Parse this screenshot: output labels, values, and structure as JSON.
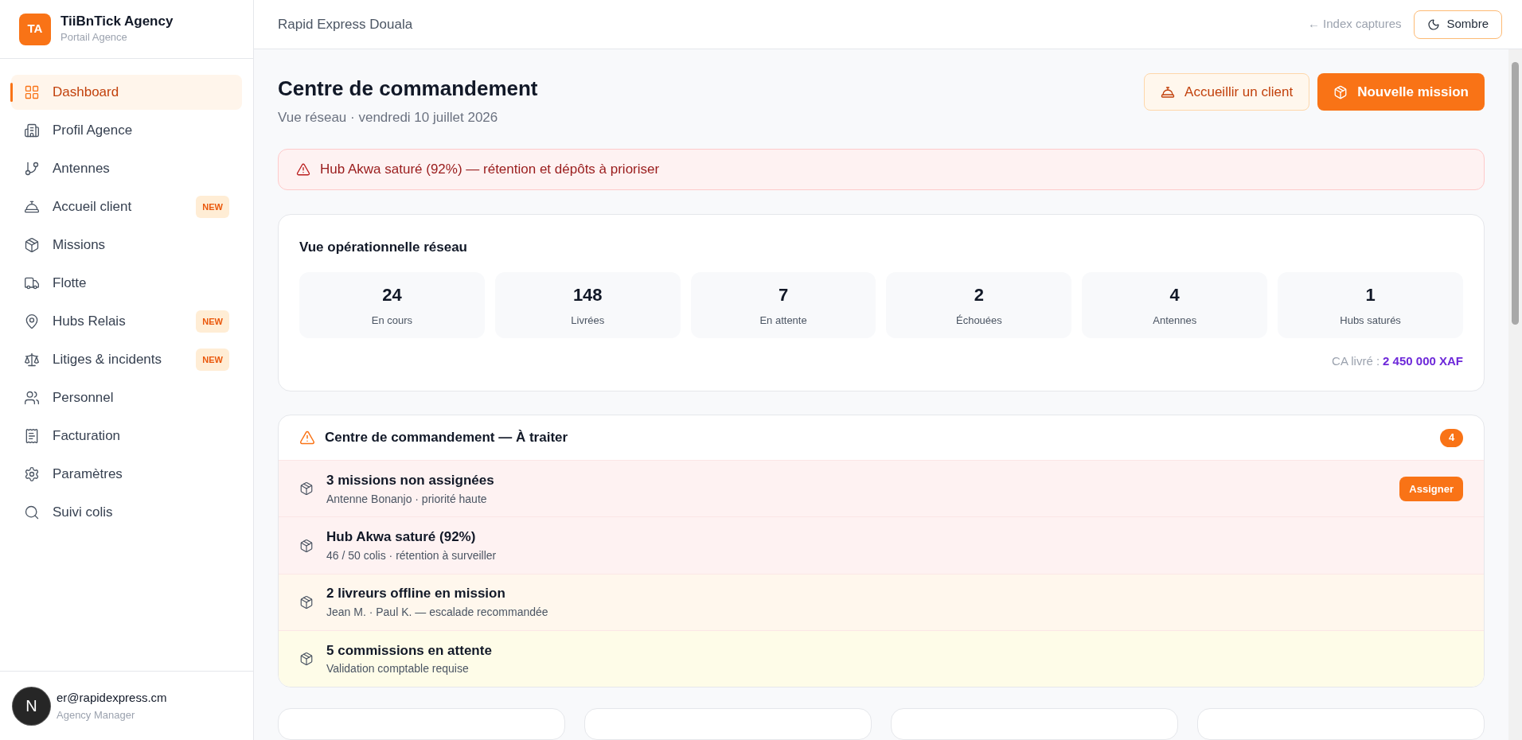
{
  "brand": {
    "initials": "TA",
    "name": "TiiBnTick Agency",
    "subtitle": "Portail Agence"
  },
  "nav": [
    {
      "label": "Dashboard",
      "selected": true
    },
    {
      "label": "Profil Agence",
      "selected": false
    },
    {
      "label": "Antennes",
      "selected": false
    },
    {
      "label": "Accueil client",
      "selected": false,
      "badge": "NEW"
    },
    {
      "label": "Missions",
      "selected": false
    },
    {
      "label": "Flotte",
      "selected": false
    },
    {
      "label": "Hubs Relais",
      "selected": false,
      "badge": "NEW"
    },
    {
      "label": "Litiges & incidents",
      "selected": false,
      "badge": "NEW"
    },
    {
      "label": "Personnel",
      "selected": false
    },
    {
      "label": "Facturation",
      "selected": false
    },
    {
      "label": "Paramètres",
      "selected": false
    },
    {
      "label": "Suivi colis",
      "selected": false
    }
  ],
  "user": {
    "bubble": "N",
    "email_visible": "er@rapidexpress.cm",
    "role": "Agency Manager"
  },
  "header": {
    "agency": "Rapid Express Douala",
    "link": "← Index captures",
    "theme_button": "Sombre"
  },
  "page": {
    "title": "Centre de commandement",
    "subtitle": "Vue réseau · vendredi 10 juillet 2026",
    "buttons": [
      {
        "label": "Accueillir un client",
        "kind": "secondary"
      },
      {
        "label": "Nouvelle mission",
        "kind": "primary"
      }
    ]
  },
  "alert": "Hub Akwa saturé (92%) — rétention et dépôts à prioriser",
  "overview": {
    "title": "Vue opérationnelle réseau",
    "stats": [
      {
        "value": "24",
        "label": "En cours"
      },
      {
        "value": "148",
        "label": "Livrées"
      },
      {
        "value": "7",
        "label": "En attente"
      },
      {
        "value": "2",
        "label": "Échouées"
      },
      {
        "value": "4",
        "label": "Antennes"
      },
      {
        "value": "1",
        "label": "Hubs saturés"
      }
    ],
    "revenue_label": "CA livré :",
    "revenue_value": "2 450 000 XAF"
  },
  "tasks": {
    "title": "Centre de commandement — À traiter",
    "count": "4",
    "items": [
      {
        "title": "3 missions non assignées",
        "detail": "Antenne Bonanjo · priorité haute",
        "color": "#fef2f2",
        "action": "Assigner"
      },
      {
        "title": "Hub Akwa saturé (92%)",
        "detail": "46 / 50 colis · rétention à surveiller",
        "color": "#fef2f2"
      },
      {
        "title": "2 livreurs offline en mission",
        "detail": "Jean M. · Paul K. — escalade recommandée",
        "color": "#fff7ed"
      },
      {
        "title": "5 commissions en attente",
        "detail": "Validation comptable requise",
        "color": "#fefce8"
      }
    ]
  }
}
